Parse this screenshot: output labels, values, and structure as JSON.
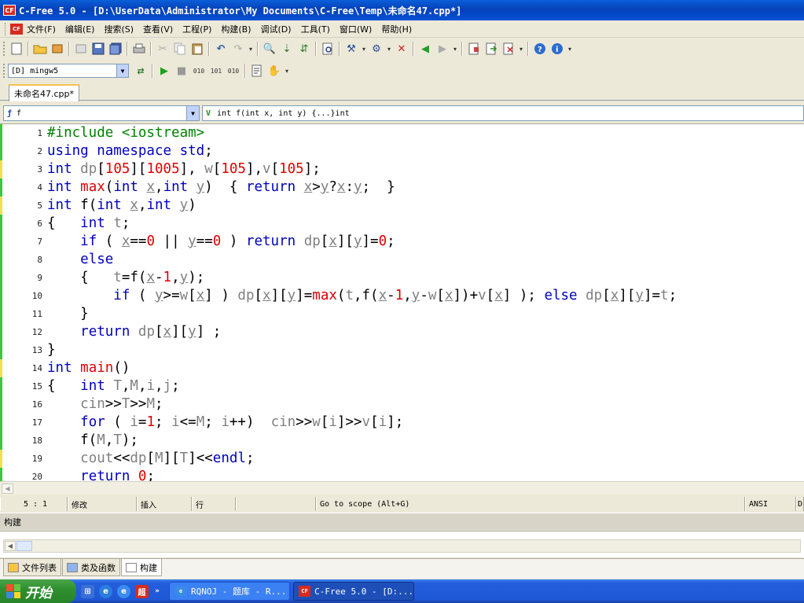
{
  "window": {
    "title": "C-Free 5.0 - [D:\\UserData\\Administrator\\My Documents\\C-Free\\Temp\\未命名47.cpp*]",
    "logo": "CF"
  },
  "menu": [
    "文件(F)",
    "编辑(E)",
    "搜索(S)",
    "查看(V)",
    "工程(P)",
    "构建(B)",
    "调试(D)",
    "工具(T)",
    "窗口(W)",
    "帮助(H)"
  ],
  "compiler": {
    "value": "[D] mingw5"
  },
  "file_tab": {
    "label": "未命名47.cpp*"
  },
  "scope": {
    "left_value": "f",
    "right_value": "int f(int x, int y) {...}int"
  },
  "code_lines": [
    {
      "n": "1",
      "mark": "green",
      "tokens": [
        [
          "pp",
          "#include <iostream>"
        ]
      ]
    },
    {
      "n": "2",
      "mark": "green",
      "tokens": [
        [
          "kw",
          "using namespace std"
        ],
        [
          "n",
          ";"
        ]
      ]
    },
    {
      "n": "3",
      "mark": "yellow",
      "tokens": [
        [
          "kw",
          "int "
        ],
        [
          "gr",
          "dp"
        ],
        [
          "n",
          "["
        ],
        [
          "num",
          "105"
        ],
        [
          "n",
          "]["
        ],
        [
          "num",
          "1005"
        ],
        [
          "n",
          "], "
        ],
        [
          "gr",
          "w"
        ],
        [
          "n",
          "["
        ],
        [
          "num",
          "105"
        ],
        [
          "n",
          "],"
        ],
        [
          "gr",
          "v"
        ],
        [
          "n",
          "["
        ],
        [
          "num",
          "105"
        ],
        [
          "n",
          "];"
        ]
      ]
    },
    {
      "n": "4",
      "mark": "green",
      "tokens": [
        [
          "kw",
          "int "
        ],
        [
          "num",
          "max"
        ],
        [
          "n",
          "("
        ],
        [
          "kw",
          "int "
        ],
        [
          "id",
          "x"
        ],
        [
          "n",
          ","
        ],
        [
          "kw",
          "int "
        ],
        [
          "id",
          "y"
        ],
        [
          "n",
          ")  { "
        ],
        [
          "kw",
          "return "
        ],
        [
          "id",
          "x"
        ],
        [
          "n",
          ">"
        ],
        [
          "id",
          "y"
        ],
        [
          "n",
          "?"
        ],
        [
          "id",
          "x"
        ],
        [
          "n",
          ":"
        ],
        [
          "id",
          "y"
        ],
        [
          "n",
          ";  }"
        ]
      ]
    },
    {
      "n": "5",
      "mark": "yellow",
      "tokens": [
        [
          "kw",
          "int "
        ],
        [
          "n",
          "f("
        ],
        [
          "kw",
          "int "
        ],
        [
          "id",
          "x"
        ],
        [
          "n",
          ","
        ],
        [
          "kw",
          "int "
        ],
        [
          "id",
          "y"
        ],
        [
          "n",
          ")"
        ]
      ]
    },
    {
      "n": "6",
      "mark": "green",
      "tokens": [
        [
          "n",
          "{   "
        ],
        [
          "kw",
          "int "
        ],
        [
          "gr",
          "t"
        ],
        [
          "n",
          ";"
        ]
      ]
    },
    {
      "n": "7",
      "mark": "green",
      "tokens": [
        [
          "n",
          "    "
        ],
        [
          "kw",
          "if"
        ],
        [
          "n",
          " ( "
        ],
        [
          "id",
          "x"
        ],
        [
          "n",
          "=="
        ],
        [
          "num",
          "0"
        ],
        [
          "n",
          " || "
        ],
        [
          "id",
          "y"
        ],
        [
          "n",
          "=="
        ],
        [
          "num",
          "0"
        ],
        [
          "n",
          " ) "
        ],
        [
          "kw",
          "return "
        ],
        [
          "gr",
          "dp"
        ],
        [
          "n",
          "["
        ],
        [
          "id",
          "x"
        ],
        [
          "n",
          "]["
        ],
        [
          "id",
          "y"
        ],
        [
          "n",
          "]="
        ],
        [
          "num",
          "0"
        ],
        [
          "n",
          ";"
        ]
      ]
    },
    {
      "n": "8",
      "mark": "green",
      "tokens": [
        [
          "n",
          "    "
        ],
        [
          "kw",
          "else"
        ]
      ]
    },
    {
      "n": "9",
      "mark": "green",
      "tokens": [
        [
          "n",
          "    {   "
        ],
        [
          "gr",
          "t"
        ],
        [
          "n",
          "=f("
        ],
        [
          "id",
          "x"
        ],
        [
          "n",
          "-"
        ],
        [
          "num",
          "1"
        ],
        [
          "n",
          ","
        ],
        [
          "id",
          "y"
        ],
        [
          "n",
          ");"
        ]
      ]
    },
    {
      "n": "10",
      "mark": "green",
      "tokens": [
        [
          "n",
          "        "
        ],
        [
          "kw",
          "if"
        ],
        [
          "n",
          " ( "
        ],
        [
          "id",
          "y"
        ],
        [
          "n",
          ">="
        ],
        [
          "gr",
          "w"
        ],
        [
          "n",
          "["
        ],
        [
          "id",
          "x"
        ],
        [
          "n",
          "] ) "
        ],
        [
          "gr",
          "dp"
        ],
        [
          "n",
          "["
        ],
        [
          "id",
          "x"
        ],
        [
          "n",
          "]["
        ],
        [
          "id",
          "y"
        ],
        [
          "n",
          "]="
        ],
        [
          "num",
          "max"
        ],
        [
          "n",
          "("
        ],
        [
          "gr",
          "t"
        ],
        [
          "n",
          ",f("
        ],
        [
          "id",
          "x"
        ],
        [
          "n",
          "-"
        ],
        [
          "num",
          "1"
        ],
        [
          "n",
          ","
        ],
        [
          "id",
          "y"
        ],
        [
          "n",
          "-"
        ],
        [
          "gr",
          "w"
        ],
        [
          "n",
          "["
        ],
        [
          "id",
          "x"
        ],
        [
          "n",
          "])+"
        ],
        [
          "gr",
          "v"
        ],
        [
          "n",
          "["
        ],
        [
          "id",
          "x"
        ],
        [
          "n",
          "] ); "
        ],
        [
          "kw",
          "else "
        ],
        [
          "gr",
          "dp"
        ],
        [
          "n",
          "["
        ],
        [
          "id",
          "x"
        ],
        [
          "n",
          "]["
        ],
        [
          "id",
          "y"
        ],
        [
          "n",
          "]="
        ],
        [
          "gr",
          "t"
        ],
        [
          "n",
          ";"
        ]
      ]
    },
    {
      "n": "11",
      "mark": "green",
      "tokens": [
        [
          "n",
          "    }"
        ]
      ]
    },
    {
      "n": "12",
      "mark": "green",
      "tokens": [
        [
          "n",
          "    "
        ],
        [
          "kw",
          "return "
        ],
        [
          "gr",
          "dp"
        ],
        [
          "n",
          "["
        ],
        [
          "id",
          "x"
        ],
        [
          "n",
          "]["
        ],
        [
          "id",
          "y"
        ],
        [
          "n",
          "] ;"
        ]
      ]
    },
    {
      "n": "13",
      "mark": "green",
      "tokens": [
        [
          "n",
          "}"
        ]
      ]
    },
    {
      "n": "14",
      "mark": "yellow",
      "tokens": [
        [
          "kw",
          "int "
        ],
        [
          "num",
          "main"
        ],
        [
          "n",
          "()"
        ]
      ]
    },
    {
      "n": "15",
      "mark": "green",
      "tokens": [
        [
          "n",
          "{   "
        ],
        [
          "kw",
          "int "
        ],
        [
          "gr",
          "T"
        ],
        [
          "n",
          ","
        ],
        [
          "gr",
          "M"
        ],
        [
          "n",
          ","
        ],
        [
          "gr",
          "i"
        ],
        [
          "n",
          ","
        ],
        [
          "gr",
          "j"
        ],
        [
          "n",
          ";"
        ]
      ]
    },
    {
      "n": "16",
      "mark": "green",
      "tokens": [
        [
          "n",
          "    "
        ],
        [
          "gr",
          "cin"
        ],
        [
          "n",
          ">>"
        ],
        [
          "gr",
          "T"
        ],
        [
          "n",
          ">>"
        ],
        [
          "gr",
          "M"
        ],
        [
          "n",
          ";"
        ]
      ]
    },
    {
      "n": "17",
      "mark": "green",
      "tokens": [
        [
          "n",
          "    "
        ],
        [
          "kw",
          "for"
        ],
        [
          "n",
          " ( "
        ],
        [
          "gr",
          "i"
        ],
        [
          "n",
          "="
        ],
        [
          "num",
          "1"
        ],
        [
          "n",
          "; "
        ],
        [
          "gr",
          "i"
        ],
        [
          "n",
          "<="
        ],
        [
          "gr",
          "M"
        ],
        [
          "n",
          "; "
        ],
        [
          "gr",
          "i"
        ],
        [
          "n",
          "++)  "
        ],
        [
          "gr",
          "cin"
        ],
        [
          "n",
          ">>"
        ],
        [
          "gr",
          "w"
        ],
        [
          "n",
          "["
        ],
        [
          "gr",
          "i"
        ],
        [
          "n",
          "]>>"
        ],
        [
          "gr",
          "v"
        ],
        [
          "n",
          "["
        ],
        [
          "gr",
          "i"
        ],
        [
          "n",
          "];"
        ]
      ]
    },
    {
      "n": "18",
      "mark": "green",
      "tokens": [
        [
          "n",
          "    f("
        ],
        [
          "gr",
          "M"
        ],
        [
          "n",
          ","
        ],
        [
          "gr",
          "T"
        ],
        [
          "n",
          ");"
        ]
      ]
    },
    {
      "n": "19",
      "mark": "yellow",
      "tokens": [
        [
          "n",
          "    "
        ],
        [
          "gr",
          "cout"
        ],
        [
          "n",
          "<<"
        ],
        [
          "gr",
          "dp"
        ],
        [
          "n",
          "["
        ],
        [
          "gr",
          "M"
        ],
        [
          "n",
          "]["
        ],
        [
          "gr",
          "T"
        ],
        [
          "n",
          "]<<"
        ],
        [
          "kw",
          "endl"
        ],
        [
          "n",
          ";"
        ]
      ]
    },
    {
      "n": "20",
      "mark": "green",
      "tokens": [
        [
          "n",
          "    "
        ],
        [
          "kw",
          "return "
        ],
        [
          "num",
          "0"
        ],
        [
          "n",
          ";"
        ]
      ]
    }
  ],
  "status": {
    "position": "5 :   1",
    "modified": "修改",
    "insert": "插入",
    "mode": "行",
    "hint": "Go to scope (Alt+G)",
    "encoding": "ANSI",
    "extra": "D"
  },
  "build_panel": {
    "title": "构建"
  },
  "panel_tabs": [
    "文件列表",
    "类及函数",
    "构建"
  ],
  "taskbar": {
    "start": "开始",
    "tasks": [
      "RQNOJ - 题库 - R...",
      "C-Free 5.0 - [D:..."
    ],
    "quick_launch": [
      "windows-flag-icon",
      "ie-icon",
      "ie-alt-icon",
      "browser-icon"
    ]
  },
  "colors": {
    "keyword": "#0000c0",
    "number": "#e00000",
    "preprocessor": "#008000",
    "identifier": "#808080",
    "title_bar": "#0540b8"
  }
}
